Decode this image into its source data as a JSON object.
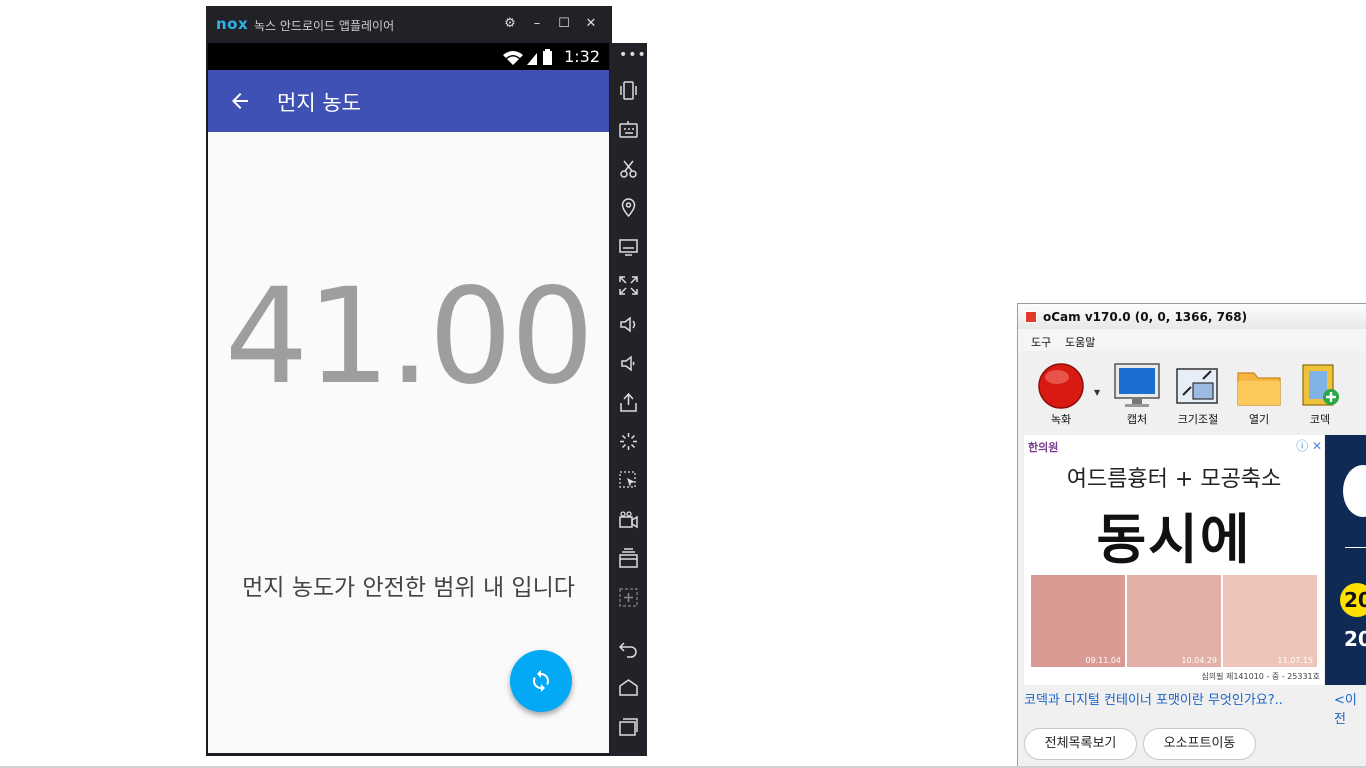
{
  "nox": {
    "logo": "nox",
    "title": "녹스 안드로이드 앱플레이어",
    "controls": {
      "settings": "⚙",
      "minimize": "–",
      "maximize": "☐",
      "close": "✕"
    }
  },
  "android": {
    "status_time": "1:32",
    "app_title": "먼지 농도",
    "dust_value": "41.00",
    "status_message": "먼지 농도가 안전한 범위 내 입니다"
  },
  "sidebar": {
    "more": "•••",
    "icons": [
      "shake-icon",
      "keyboard-icon",
      "scissors-icon",
      "location-icon",
      "screen-icon",
      "fullscreen-icon",
      "volume-up-icon",
      "volume-down-icon",
      "apk-icon",
      "loading-icon",
      "macro-icon",
      "video-record-icon",
      "multi-instance-icon",
      "add-icon",
      "back-icon",
      "home-icon",
      "recent-apps-icon"
    ]
  },
  "ocam": {
    "title": "oCam v170.0 (0, 0, 1366, 768)",
    "menu": [
      "도구",
      "도움말"
    ],
    "toolbar": [
      "녹화",
      "캡처",
      "크기조절",
      "열기",
      "코덱"
    ],
    "ad": {
      "brand": "한의원",
      "headline": "여드름흉터 + 모공축소",
      "main": "동시에",
      "dates": [
        "09.11.04",
        "10.04.29",
        "11.07.15"
      ],
      "footer": "심의필 제141010 - 중 - 25331호"
    },
    "ad2": {
      "badge": "20",
      "year": "20"
    },
    "link1": "코덱과 디지털 컨테이너 포맷이란 무엇인가요?..",
    "link2": "<이전",
    "buttons": [
      "전체목록보기",
      "오소프트이동"
    ]
  }
}
